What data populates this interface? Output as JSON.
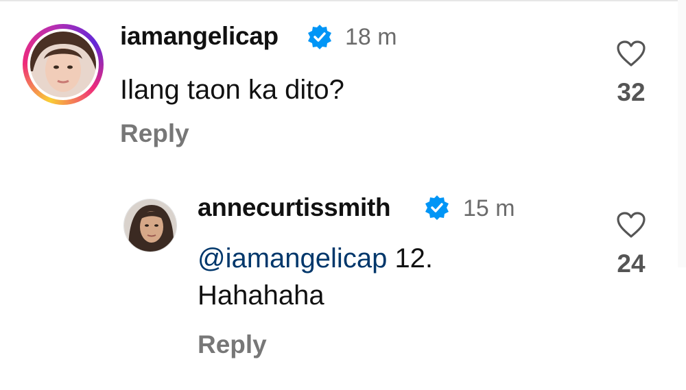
{
  "comment": {
    "username": "iamangelicap",
    "verified": true,
    "time": "18 m",
    "text": "Ilang taon ka dito?",
    "reply_label": "Reply",
    "likes": "32",
    "icons": {
      "avatar": "avatar-iamangelicap",
      "badge": "verified-badge-icon",
      "like": "heart-icon"
    }
  },
  "reply": {
    "username": "annecurtissmith",
    "verified": true,
    "time": "15 m",
    "mention": "@iamangelicap",
    "text_line1": "12.",
    "text_line2": "Hahahaha",
    "reply_label": "Reply",
    "likes": "24",
    "icons": {
      "avatar": "avatar-annecurtissmith",
      "badge": "verified-badge-icon",
      "like": "heart-icon"
    }
  },
  "colors": {
    "verified": "#0095f6",
    "mention": "#00376b",
    "muted": "#777777"
  }
}
